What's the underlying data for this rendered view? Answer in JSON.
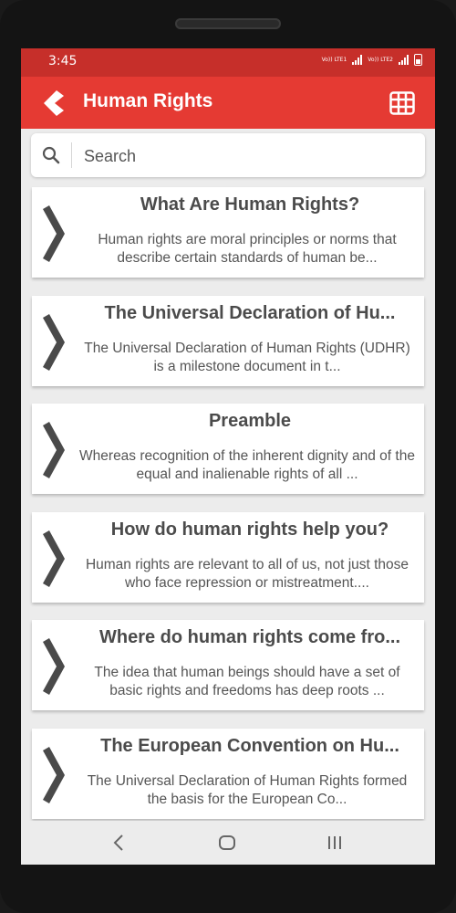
{
  "status": {
    "time": "3:45",
    "sim1": "Vo)) LTE1",
    "sim2": "Vo)) LTE2"
  },
  "appbar": {
    "title": "Human Rights"
  },
  "search": {
    "placeholder": "Search"
  },
  "colors": {
    "statusbar": "#c62f2a",
    "appbar": "#e53a33",
    "background": "#ececec"
  },
  "items": [
    {
      "title": "What Are Human Rights?",
      "description": "Human rights are moral principles or norms that describe certain standards of human be..."
    },
    {
      "title": "The Universal Declaration of Hu...",
      "description": "The Universal Declaration of Human Rights (UDHR) is a milestone document in t..."
    },
    {
      "title": "Preamble",
      "description": "Whereas recognition of the inherent dignity and of the equal and inalienable rights of all ..."
    },
    {
      "title": "How do human rights help you?",
      "description": "Human rights are relevant to all of us, not just those who face repression or mistreatment...."
    },
    {
      "title": "Where do human rights come fro...",
      "description": "The idea that human beings should have a set of basic rights and freedoms has deep roots ..."
    },
    {
      "title": "The European Convention on Hu...",
      "description": "The Universal Declaration of Human Rights formed the basis for the European Co..."
    }
  ]
}
